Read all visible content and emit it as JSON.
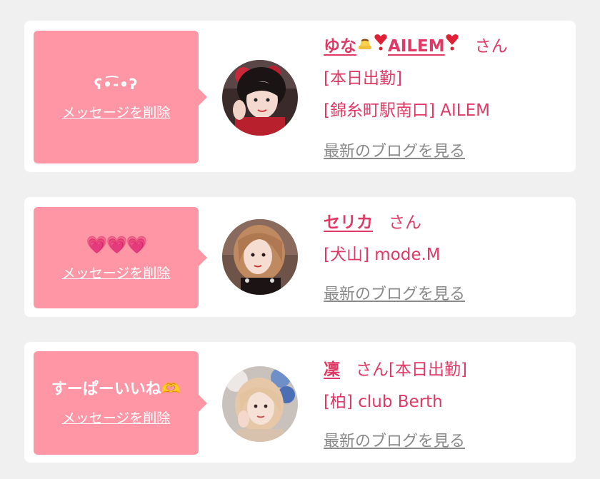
{
  "cards": [
    {
      "message": "ʕ•͡-•ʔ",
      "delete_label": "メッセージを削除",
      "name": "ゆな🍮❣️AILEM❣️",
      "name_text": "ゆな",
      "name_suffix": "AILEM",
      "honorific": "さん",
      "status": "[本日出勤]",
      "shop": "[錦糸町駅南口] AILEM",
      "blog_label": "最新のブログを見る",
      "avatar_icon": "girl-photo"
    },
    {
      "message": "💗💗💗",
      "delete_label": "メッセージを削除",
      "name": "セリカ",
      "honorific": "さん",
      "shop": "[犬山] mode.M",
      "blog_label": "最新のブログを見る",
      "avatar_icon": "girl-photo"
    },
    {
      "message": "すーぱーいいね🫶",
      "delete_label": "メッセージを削除",
      "name": "凜",
      "honorific": "さん[本日出勤]",
      "shop": "[柏] club Berth",
      "blog_label": "最新のブログを見る",
      "avatar_icon": "girl-photo"
    }
  ],
  "colors": {
    "page_bg": "#f0f0f1",
    "bubble": "#fe96a6",
    "accent_text": "#de3a65",
    "link_gray": "#8a8a8a"
  }
}
